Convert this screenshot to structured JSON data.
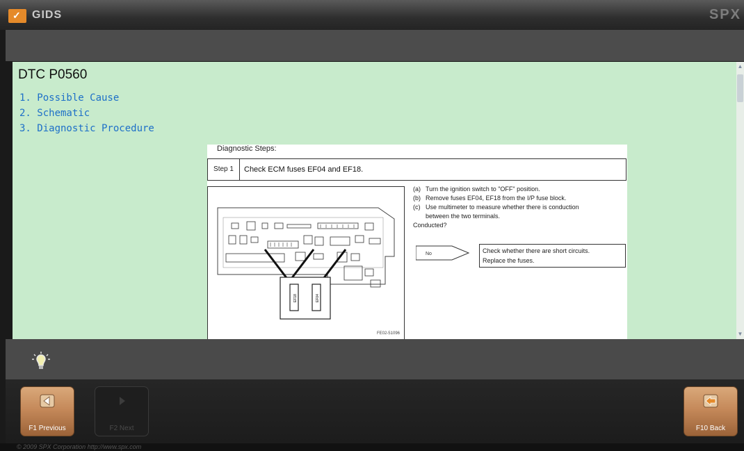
{
  "app": {
    "title": "GIDS",
    "brand": "SPX"
  },
  "page": {
    "title": "DTC P0560",
    "toc": [
      "1. Possible Cause",
      "2. Schematic",
      "3. Diagnostic Procedure"
    ]
  },
  "doc": {
    "heading": "Diagnostic Steps:",
    "step_num": "Step 1",
    "step_text": "Check ECM fuses EF04 and EF18.",
    "instructions": [
      {
        "label": "(a)",
        "text": "Turn the ignition switch to \"OFF\" position."
      },
      {
        "label": "(b)",
        "text": "Remove fuses EF04, EF18 from the I/P fuse block."
      },
      {
        "label": "(c)",
        "text": "Use multimeter to measure whether there is conduction"
      }
    ],
    "instruction_cont": "between the two terminals.",
    "question": "Conducted?",
    "no_label": "No",
    "result_lines": [
      "Check whether there are short circuits.",
      "Replace the fuses."
    ],
    "fig_code": "FE02-51096",
    "fuse_labels": [
      "EF18",
      "EF04"
    ]
  },
  "nav": {
    "previous": "F1  Previous",
    "next": "F2  Next",
    "back": "F10  Back"
  },
  "footer": "© 2009 SPX Corporation   http://www.spx.com",
  "colors": {
    "accent": "#e58a2a",
    "content_bg": "#c8ebcc",
    "link": "#1d6fc8"
  }
}
